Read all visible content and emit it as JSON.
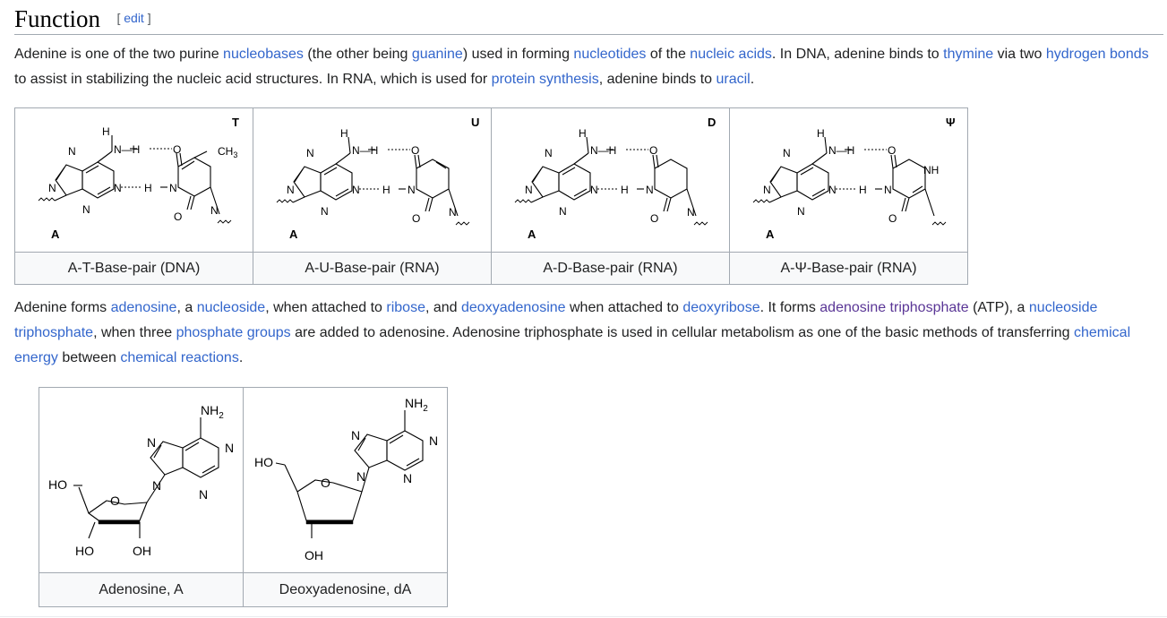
{
  "section": {
    "title": "Function",
    "edit_open": "[ ",
    "edit_label": "edit",
    "edit_close": " ]"
  },
  "para1": {
    "t0": "Adenine is one of the two purine ",
    "l_nucleobases": "nucleobases",
    "t1": " (the other being ",
    "l_guanine": "guanine",
    "t2": ") used in forming ",
    "l_nucleotides": "nucleotides",
    "t3": " of the ",
    "l_nucleic_acids": "nucleic acids",
    "t4": ". In DNA, adenine binds to ",
    "l_thymine": "thymine",
    "t5": " via two ",
    "l_hydrogen_bonds": "hydrogen bonds",
    "t6": " to assist in stabilizing the nucleic acid structures. In RNA, which is used for ",
    "l_protein_synthesis": "protein synthesis",
    "t7": ", adenine binds to ",
    "l_uracil": "uracil",
    "t8": "."
  },
  "basepairs": [
    {
      "caption": "A-T-Base-pair (DNA)",
      "partner": "T",
      "base": "A"
    },
    {
      "caption": "A-U-Base-pair (RNA)",
      "partner": "U",
      "base": "A"
    },
    {
      "caption": "A-D-Base-pair (RNA)",
      "partner": "D",
      "base": "A"
    },
    {
      "caption": "A-Ψ-Base-pair (RNA)",
      "partner": "Ψ",
      "base": "A"
    }
  ],
  "atoms": {
    "H": "H",
    "N": "N",
    "O": "O",
    "C": "C",
    "NH": "NH",
    "CH": "CH",
    "sub3": "3",
    "sub2": "2",
    "HO": "HO",
    "OH": "OH"
  },
  "para2": {
    "t0": "Adenine forms ",
    "l_adenosine": "adenosine",
    "t1": ", a ",
    "l_nucleoside": "nucleoside",
    "t2": ", when attached to ",
    "l_ribose": "ribose",
    "t3": ", and ",
    "l_deoxyadenosine": "deoxyadenosine",
    "t4": " when attached to ",
    "l_deoxyribose": "deoxyribose",
    "t5": ". It forms ",
    "l_atp": "adenosine triphosphate",
    "t6": " (ATP), a ",
    "l_nucleoside_triphosphate": "nucleoside triphosphate",
    "t7": ", when three ",
    "l_phosphate_groups": "phosphate groups",
    "t8": " are added to adenosine. Adenosine triphosphate is used in cellular metabolism as one of the basic methods of transferring ",
    "l_chemical_energy": "chemical energy",
    "t9": " between ",
    "l_chemical_reactions": "chemical reactions",
    "t10": "."
  },
  "nucleosides": [
    {
      "caption": "Adenosine, A"
    },
    {
      "caption": "Deoxyadenosine, dA"
    }
  ],
  "colors": {
    "link": "#3366cc",
    "visited_link": "#5a3696",
    "border": "#a2a9b1",
    "caption_bg": "#f8f9fa"
  }
}
